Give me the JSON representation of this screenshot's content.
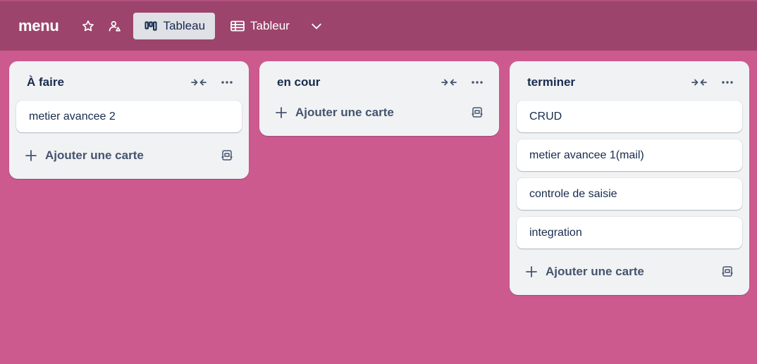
{
  "header": {
    "board_title": "menu",
    "views": [
      {
        "label": "Tableau",
        "active": true
      },
      {
        "label": "Tableur",
        "active": false
      }
    ]
  },
  "colors": {
    "background": "#cd5a8e",
    "header": "#9c446c",
    "list": "#f1f2f4",
    "text": "#172b4d"
  },
  "lists": [
    {
      "title": "À faire",
      "cards": [
        "metier avancee 2"
      ],
      "add_label": "Ajouter une carte"
    },
    {
      "title": "en cour",
      "cards": [],
      "add_label": "Ajouter une carte"
    },
    {
      "title": "terminer",
      "cards": [
        "CRUD",
        "metier avancee 1(mail)",
        "controle de saisie",
        "integration"
      ],
      "add_label": "Ajouter une carte"
    }
  ]
}
